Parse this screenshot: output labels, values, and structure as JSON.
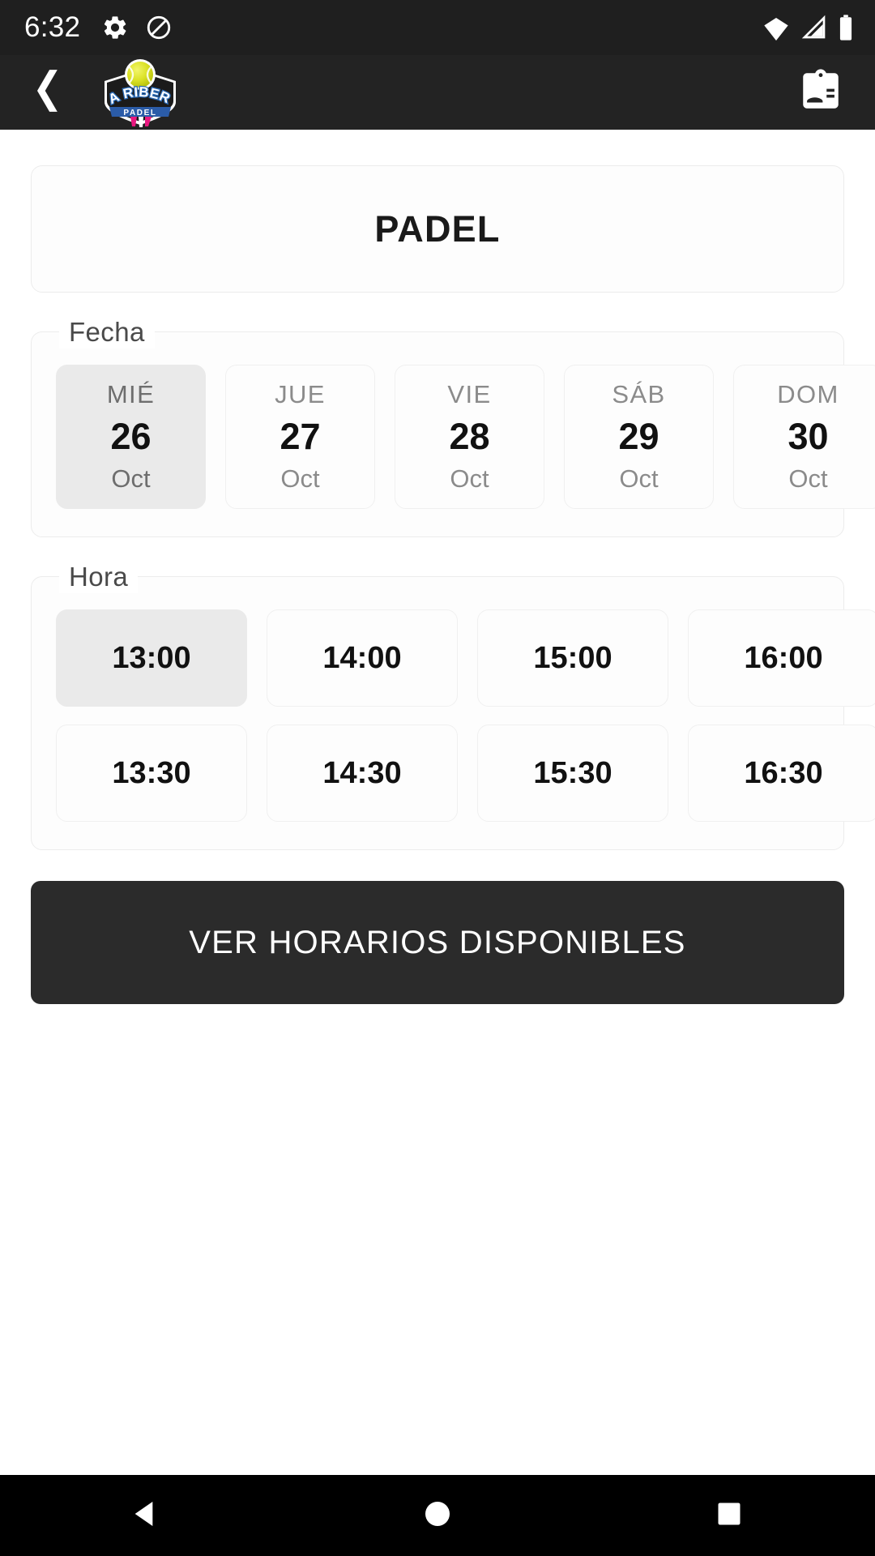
{
  "status_bar": {
    "clock": "6:32",
    "icons": [
      "gear-icon",
      "do-not-disturb-icon"
    ],
    "right_icons": [
      "wifi-icon",
      "cellular-signal-icon",
      "battery-icon"
    ],
    "background_color": "#1f1f1f"
  },
  "app_bar": {
    "back_label": "back-arrow-icon",
    "logo": {
      "line1": "LA RIBERA",
      "line2": "PADEL",
      "ball_color": "#d9e021",
      "text_color": "#2b6cb8"
    },
    "action_icon": "contact-card-icon",
    "background_color": "#232323"
  },
  "main": {
    "title": "PADEL",
    "date_section": {
      "legend": "Fecha",
      "selected_index": 0,
      "chips": [
        {
          "dow": "MIÉ",
          "day": "26",
          "month": "Oct",
          "selected": true
        },
        {
          "dow": "JUE",
          "day": "27",
          "month": "Oct",
          "selected": false
        },
        {
          "dow": "VIE",
          "day": "28",
          "month": "Oct",
          "selected": false
        },
        {
          "dow": "SÁB",
          "day": "29",
          "month": "Oct",
          "selected": false
        },
        {
          "dow": "DOM",
          "day": "30",
          "month": "Oct",
          "selected": false
        }
      ]
    },
    "time_section": {
      "legend": "Hora",
      "selected_time": "13:00",
      "slots": [
        {
          "time": "13:00",
          "selected": true
        },
        {
          "time": "14:00",
          "selected": false
        },
        {
          "time": "15:00",
          "selected": false
        },
        {
          "time": "16:00",
          "selected": false
        },
        {
          "time": "13:30",
          "selected": false
        },
        {
          "time": "14:30",
          "selected": false
        },
        {
          "time": "15:30",
          "selected": false
        },
        {
          "time": "16:30",
          "selected": false
        }
      ]
    },
    "cta": {
      "label": "VER HORARIOS DISPONIBLES",
      "background_color": "#2b2b2b",
      "text_color": "#ffffff"
    }
  },
  "nav_bar": {
    "back": "nav-back-triangle-icon",
    "home": "nav-home-circle-icon",
    "recents": "nav-recents-square-icon",
    "background_color": "#000000"
  }
}
